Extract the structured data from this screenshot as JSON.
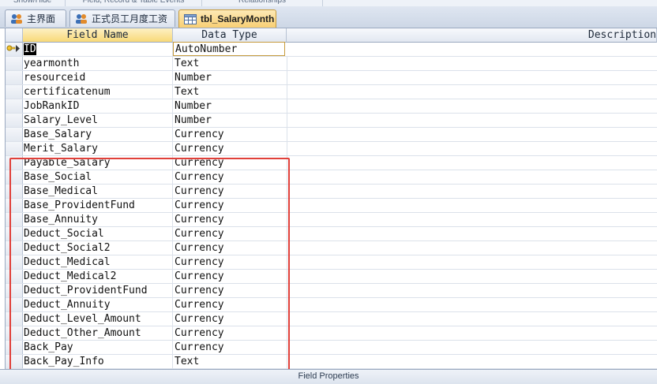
{
  "ribbon_groups": [
    "Show/Hide",
    "Field, Record & Table Events",
    "Relationships"
  ],
  "tabs": [
    {
      "label": "主界面",
      "icon": "form-users-icon",
      "active": false
    },
    {
      "label": "正式员工月度工资",
      "icon": "form-users-icon",
      "active": false
    },
    {
      "label": "tbl_SalaryMonth",
      "icon": "table-icon",
      "active": true
    }
  ],
  "grid": {
    "headers": {
      "field_name": "Field Name",
      "data_type": "Data Type",
      "description": "Description"
    },
    "rows": [
      {
        "name": "ID",
        "type": "AutoNumber",
        "primary_key": true
      },
      {
        "name": "yearmonth",
        "type": "Text"
      },
      {
        "name": "resourceid",
        "type": "Number"
      },
      {
        "name": "certificatenum",
        "type": "Text"
      },
      {
        "name": "JobRankID",
        "type": "Number"
      },
      {
        "name": "Salary_Level",
        "type": "Number"
      },
      {
        "name": "Base_Salary",
        "type": "Currency"
      },
      {
        "name": "Merit_Salary",
        "type": "Currency"
      },
      {
        "name": "Payable_Salary",
        "type": "Currency"
      },
      {
        "name": "Base_Social",
        "type": "Currency"
      },
      {
        "name": "Base_Medical",
        "type": "Currency"
      },
      {
        "name": "Base_ProvidentFund",
        "type": "Currency"
      },
      {
        "name": "Base_Annuity",
        "type": "Currency"
      },
      {
        "name": "Deduct_Social",
        "type": "Currency"
      },
      {
        "name": "Deduct_Social2",
        "type": "Currency"
      },
      {
        "name": "Deduct_Medical",
        "type": "Currency"
      },
      {
        "name": "Deduct_Medical2",
        "type": "Currency"
      },
      {
        "name": "Deduct_ProvidentFund",
        "type": "Currency"
      },
      {
        "name": "Deduct_Annuity",
        "type": "Currency"
      },
      {
        "name": "Deduct_Level_Amount",
        "type": "Currency"
      },
      {
        "name": "Deduct_Other_Amount",
        "type": "Currency"
      },
      {
        "name": "Back_Pay",
        "type": "Currency"
      },
      {
        "name": "Back_Pay_Info",
        "type": "Text"
      }
    ]
  },
  "field_properties_label": "Field Properties",
  "colors": {
    "highlight_box": "#e0403a",
    "active_tab": "#f8cf74"
  }
}
